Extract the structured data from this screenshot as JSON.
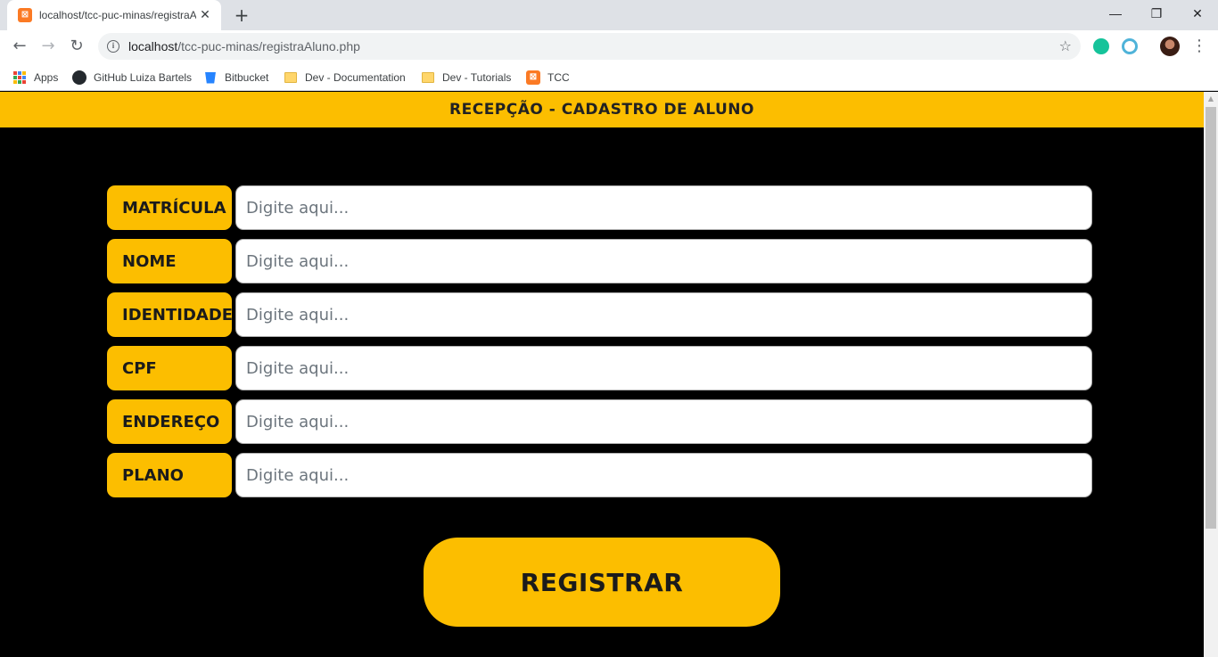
{
  "browser": {
    "tab": {
      "favicon": "xampp-icon",
      "title": "localhost/tcc-puc-minas/registraAluno.php",
      "close_label": "✕"
    },
    "new_tab_label": "+",
    "window_controls": {
      "minimize": "—",
      "maximize": "❐",
      "close": "✕"
    },
    "address": {
      "host": "localhost",
      "path": "/tcc-puc-minas/registraAluno.php"
    },
    "bookmarks": [
      {
        "label": "Apps",
        "icon": "apps-grid-icon"
      },
      {
        "label": "GitHub Luiza Bartels",
        "icon": "github-icon"
      },
      {
        "label": "Bitbucket",
        "icon": "bitbucket-icon"
      },
      {
        "label": "Dev - Documentation",
        "icon": "folder-icon"
      },
      {
        "label": "Dev - Tutorials",
        "icon": "folder-icon"
      },
      {
        "label": "TCC",
        "icon": "xampp-icon"
      }
    ],
    "extensions": [
      {
        "icon": "grammarly-icon",
        "color": "#15c39a"
      },
      {
        "icon": "extension-icon",
        "color": "#4fb3d9"
      }
    ]
  },
  "page": {
    "header_title": "RECEPÇÃO - CADASTRO DE ALUNO",
    "fields": [
      {
        "label": "MATRÍCULA",
        "placeholder": "Digite aqui...",
        "value": ""
      },
      {
        "label": "NOME",
        "placeholder": "Digite aqui...",
        "value": ""
      },
      {
        "label": "IDENTIDADE",
        "placeholder": "Digite aqui...",
        "value": ""
      },
      {
        "label": "CPF",
        "placeholder": "Digite aqui...",
        "value": ""
      },
      {
        "label": "ENDEREÇO",
        "placeholder": "Digite aqui...",
        "value": ""
      },
      {
        "label": "PLANO",
        "placeholder": "Digite aqui...",
        "value": ""
      }
    ],
    "submit_label": "REGISTRAR"
  },
  "colors": {
    "accent": "#fcbe00",
    "background": "#000000",
    "input_bg": "#ffffff"
  }
}
